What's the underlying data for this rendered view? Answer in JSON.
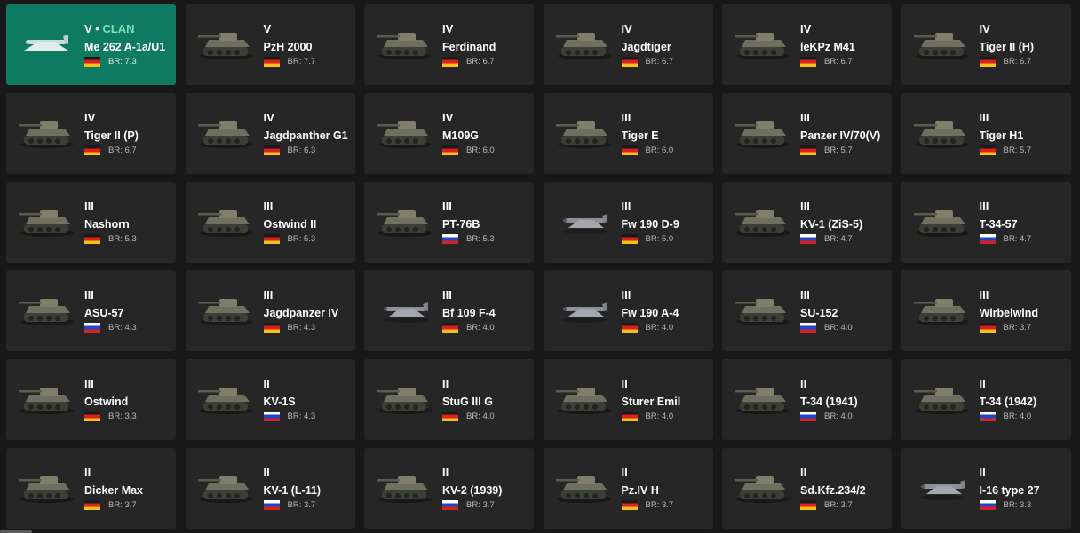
{
  "colors": {
    "background": "#181818",
    "card": "#262626",
    "selected_card": "#0f7a62",
    "clan_accent": "#7fe0c0",
    "br_text": "#b9b9b9"
  },
  "vehicles": [
    {
      "rank": "V",
      "clan": "CLAN",
      "name": "Me 262 A-1a/U1",
      "country": "germany",
      "br": "BR: 7.3",
      "kind": "plane",
      "selected": true
    },
    {
      "rank": "V",
      "name": "PzH 2000",
      "country": "germany",
      "br": "BR: 7.7",
      "kind": "tank"
    },
    {
      "rank": "IV",
      "name": "Ferdinand",
      "country": "germany",
      "br": "BR: 6.7",
      "kind": "tank"
    },
    {
      "rank": "IV",
      "name": "Jagdtiger",
      "country": "germany",
      "br": "BR: 6.7",
      "kind": "tank"
    },
    {
      "rank": "IV",
      "name": "leKPz M41",
      "country": "germany",
      "br": "BR: 6.7",
      "kind": "tank"
    },
    {
      "rank": "IV",
      "name": "Tiger II (H)",
      "country": "germany",
      "br": "BR: 6.7",
      "kind": "tank"
    },
    {
      "rank": "IV",
      "name": "Tiger II (P)",
      "country": "germany",
      "br": "BR: 6.7",
      "kind": "tank"
    },
    {
      "rank": "IV",
      "name": "Jagdpanther G1",
      "country": "germany",
      "br": "BR: 6.3",
      "kind": "tank"
    },
    {
      "rank": "IV",
      "name": "M109G",
      "country": "germany",
      "br": "BR: 6.0",
      "kind": "tank"
    },
    {
      "rank": "III",
      "name": "Tiger E",
      "country": "germany",
      "br": "BR: 6.0",
      "kind": "tank"
    },
    {
      "rank": "III",
      "name": "Panzer IV/70(V)",
      "country": "germany",
      "br": "BR: 5.7",
      "kind": "tank"
    },
    {
      "rank": "III",
      "name": "Tiger H1",
      "country": "germany",
      "br": "BR: 5.7",
      "kind": "tank"
    },
    {
      "rank": "III",
      "name": "Nashorn",
      "country": "germany",
      "br": "BR: 5.3",
      "kind": "tank"
    },
    {
      "rank": "III",
      "name": "Ostwind II",
      "country": "germany",
      "br": "BR: 5.3",
      "kind": "tank"
    },
    {
      "rank": "III",
      "name": "PT-76B",
      "country": "ussr",
      "br": "BR: 5.3",
      "kind": "tank"
    },
    {
      "rank": "III",
      "name": "Fw 190 D-9",
      "country": "germany",
      "br": "BR: 5.0",
      "kind": "plane"
    },
    {
      "rank": "III",
      "name": "KV-1 (ZiS-5)",
      "country": "ussr",
      "br": "BR: 4.7",
      "kind": "tank"
    },
    {
      "rank": "III",
      "name": "T-34-57",
      "country": "ussr",
      "br": "BR: 4.7",
      "kind": "tank"
    },
    {
      "rank": "III",
      "name": "ASU-57",
      "country": "ussr",
      "br": "BR: 4.3",
      "kind": "tank"
    },
    {
      "rank": "III",
      "name": "Jagdpanzer IV",
      "country": "germany",
      "br": "BR: 4.3",
      "kind": "tank"
    },
    {
      "rank": "III",
      "name": "Bf 109 F-4",
      "country": "germany",
      "br": "BR: 4.0",
      "kind": "plane"
    },
    {
      "rank": "III",
      "name": "Fw 190 A-4",
      "country": "germany",
      "br": "BR: 4.0",
      "kind": "plane"
    },
    {
      "rank": "III",
      "name": "SU-152",
      "country": "ussr",
      "br": "BR: 4.0",
      "kind": "tank"
    },
    {
      "rank": "III",
      "name": "Wirbelwind",
      "country": "germany",
      "br": "BR: 3.7",
      "kind": "tank"
    },
    {
      "rank": "III",
      "name": "Ostwind",
      "country": "germany",
      "br": "BR: 3.3",
      "kind": "tank"
    },
    {
      "rank": "II",
      "name": "KV-1S",
      "country": "ussr",
      "br": "BR: 4.3",
      "kind": "tank"
    },
    {
      "rank": "II",
      "name": "StuG III G",
      "country": "germany",
      "br": "BR: 4.0",
      "kind": "tank"
    },
    {
      "rank": "II",
      "name": "Sturer Emil",
      "country": "germany",
      "br": "BR: 4.0",
      "kind": "tank"
    },
    {
      "rank": "II",
      "name": "T-34 (1941)",
      "country": "ussr",
      "br": "BR: 4.0",
      "kind": "tank"
    },
    {
      "rank": "II",
      "name": "T-34 (1942)",
      "country": "ussr",
      "br": "BR: 4.0",
      "kind": "tank"
    },
    {
      "rank": "II",
      "name": "Dicker Max",
      "country": "germany",
      "br": "BR: 3.7",
      "kind": "tank"
    },
    {
      "rank": "II",
      "name": "KV-1 (L-11)",
      "country": "ussr",
      "br": "BR: 3.7",
      "kind": "tank"
    },
    {
      "rank": "II",
      "name": "KV-2 (1939)",
      "country": "ussr",
      "br": "BR: 3.7",
      "kind": "tank"
    },
    {
      "rank": "II",
      "name": "Pz.IV H",
      "country": "germany",
      "br": "BR: 3.7",
      "kind": "tank"
    },
    {
      "rank": "II",
      "name": "Sd.Kfz.234/2",
      "country": "germany",
      "br": "BR: 3.7",
      "kind": "tank"
    },
    {
      "rank": "II",
      "name": "I-16 type 27",
      "country": "ussr",
      "br": "BR: 3.3",
      "kind": "plane"
    }
  ]
}
